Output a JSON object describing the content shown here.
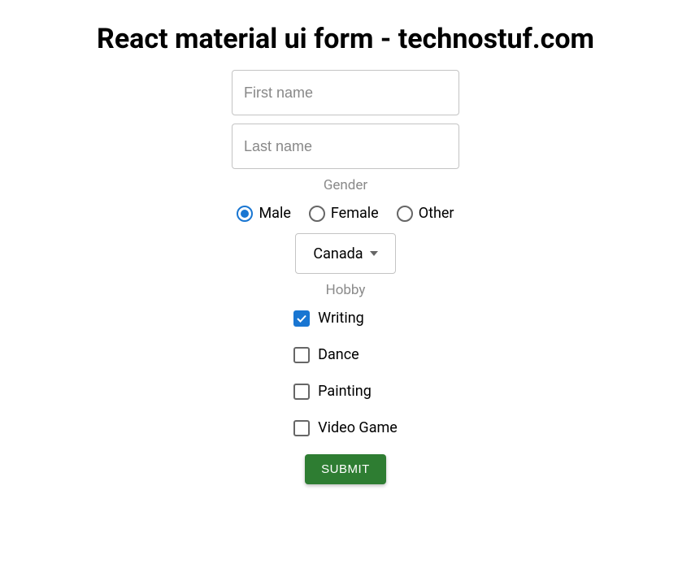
{
  "title": "React material ui form - technostuf.com",
  "firstName": {
    "placeholder": "First name",
    "value": ""
  },
  "lastName": {
    "placeholder": "Last name",
    "value": ""
  },
  "genderLabel": "Gender",
  "gender": {
    "options": [
      {
        "label": "Male",
        "selected": true
      },
      {
        "label": "Female",
        "selected": false
      },
      {
        "label": "Other",
        "selected": false
      }
    ]
  },
  "country": {
    "selected": "Canada"
  },
  "hobbyLabel": "Hobby",
  "hobbies": [
    {
      "label": "Writing",
      "checked": true
    },
    {
      "label": "Dance",
      "checked": false
    },
    {
      "label": "Painting",
      "checked": false
    },
    {
      "label": "Video Game",
      "checked": false
    }
  ],
  "submitLabel": "SUBMIT"
}
